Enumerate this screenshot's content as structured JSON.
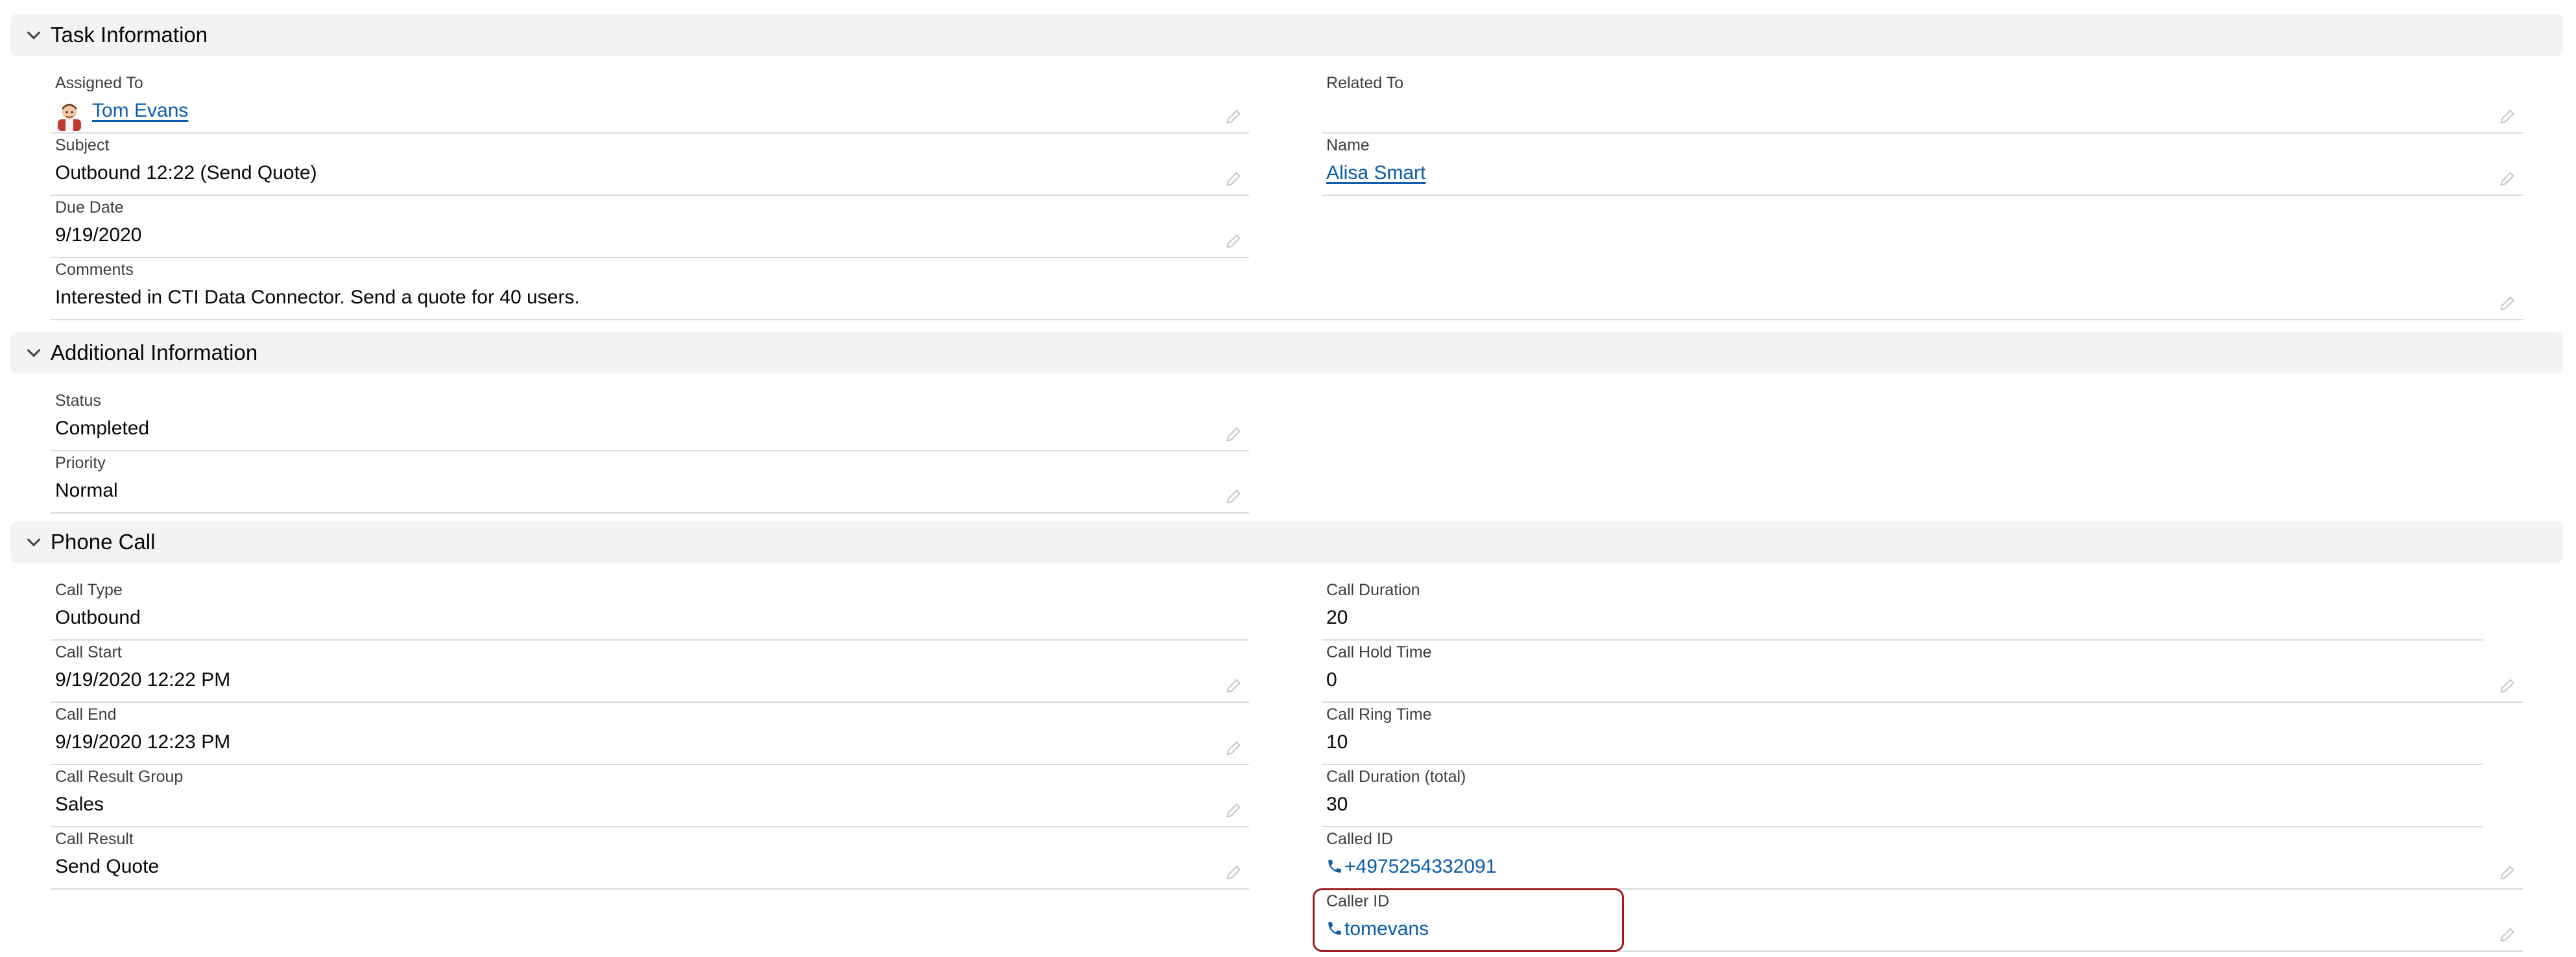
{
  "sections": {
    "task": {
      "title": "Task Information"
    },
    "additional": {
      "title": "Additional Information"
    },
    "phone": {
      "title": "Phone Call"
    }
  },
  "task": {
    "assigned_to": {
      "label": "Assigned To",
      "value": "Tom Evans"
    },
    "related_to": {
      "label": "Related To",
      "value": ""
    },
    "subject": {
      "label": "Subject",
      "value": "Outbound 12:22 (Send Quote)"
    },
    "name": {
      "label": "Name",
      "value": "Alisa Smart"
    },
    "due_date": {
      "label": "Due Date",
      "value": "9/19/2020"
    },
    "comments": {
      "label": "Comments",
      "value": "Interested in CTI Data Connector. Send a quote for 40 users."
    }
  },
  "additional": {
    "status": {
      "label": "Status",
      "value": "Completed"
    },
    "priority": {
      "label": "Priority",
      "value": "Normal"
    }
  },
  "phone": {
    "call_type": {
      "label": "Call Type",
      "value": "Outbound"
    },
    "call_duration": {
      "label": "Call Duration",
      "value": "20"
    },
    "call_start": {
      "label": "Call Start",
      "value": "9/19/2020 12:22 PM"
    },
    "call_hold_time": {
      "label": "Call Hold Time",
      "value": "0"
    },
    "call_end": {
      "label": "Call End",
      "value": "9/19/2020 12:23 PM"
    },
    "call_ring_time": {
      "label": "Call Ring Time",
      "value": "10"
    },
    "call_result_group": {
      "label": "Call Result Group",
      "value": "Sales"
    },
    "call_duration_total": {
      "label": "Call Duration (total)",
      "value": "30"
    },
    "call_result": {
      "label": "Call Result",
      "value": "Send Quote"
    },
    "called_id": {
      "label": "Called ID",
      "value": "+4975254332091"
    },
    "caller_id": {
      "label": "Caller ID",
      "value": "tomevans"
    }
  },
  "icons": {
    "chevron": "chevron-down-icon",
    "edit": "pencil-icon",
    "phone": "phone-icon",
    "avatar": "avatar"
  },
  "colors": {
    "link": "#0b5cab",
    "section_bg": "#f3f3f3",
    "highlight_border": "#9b1b1f"
  }
}
